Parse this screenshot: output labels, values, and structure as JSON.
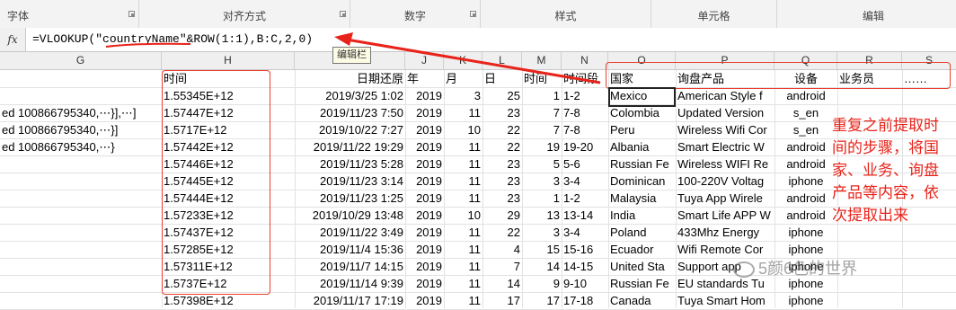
{
  "ribbon": {
    "groups": [
      {
        "label": "字体",
        "launcher": true
      },
      {
        "label": "对齐方式",
        "launcher": true
      },
      {
        "label": "数字",
        "launcher": true
      },
      {
        "label": "样式",
        "launcher": false
      },
      {
        "label": "单元格",
        "launcher": false
      },
      {
        "label": "编辑",
        "launcher": false
      }
    ]
  },
  "formula_bar": {
    "fx_label": "fx",
    "formula": "=VLOOKUP(\"countryName\"&ROW(1:1),B:C,2,0)",
    "tooltip": "编辑栏"
  },
  "columns": [
    "G",
    "H",
    "I",
    "J",
    "K",
    "L",
    "M",
    "N",
    "O",
    "P",
    "Q",
    "R",
    "S"
  ],
  "header_row": {
    "H": "时间",
    "I": "日期还原",
    "J": "年",
    "K": "月",
    "L": "日",
    "M": "时间",
    "N": "时间段",
    "O": "国家",
    "P": "询盘产品",
    "Q": "设备",
    "R": "业务员",
    "S": "……"
  },
  "rows": [
    {
      "F": "",
      "G": "",
      "H": "1.55345E+12",
      "I": "2019/3/25 1:02",
      "J": "2019",
      "K": "3",
      "L": "25",
      "M": "1",
      "N": "1-2",
      "O": "Mexico",
      "P": "American Style f",
      "Q": "android",
      "R": ""
    },
    {
      "F": "ed",
      "G": "100866795340,⋯}],⋯]",
      "H": "1.57447E+12",
      "I": "2019/11/23 7:50",
      "J": "2019",
      "K": "11",
      "L": "23",
      "M": "7",
      "N": "7-8",
      "O": "Colombia",
      "P": "Updated Version",
      "Q": "s_en",
      "R": ""
    },
    {
      "F": "ed",
      "G": "100866795340,⋯}]",
      "H": "1.5717E+12",
      "I": "2019/10/22 7:27",
      "J": "2019",
      "K": "10",
      "L": "22",
      "M": "7",
      "N": "7-8",
      "O": "Peru",
      "P": "Wireless Wifi Cor",
      "Q": "s_en",
      "R": ""
    },
    {
      "F": "ed",
      "G": "100866795340,⋯}",
      "H": "1.57442E+12",
      "I": "2019/11/22 19:29",
      "J": "2019",
      "K": "11",
      "L": "22",
      "M": "19",
      "N": "19-20",
      "O": "Albania",
      "P": "Smart Electric W",
      "Q": "android",
      "R": ""
    },
    {
      "F": "",
      "G": "",
      "H": "1.57446E+12",
      "I": "2019/11/23 5:28",
      "J": "2019",
      "K": "11",
      "L": "23",
      "M": "5",
      "N": "5-6",
      "O": "Russian Fe",
      "P": "Wireless WIFI Re",
      "Q": "android",
      "R": ""
    },
    {
      "F": "",
      "G": "",
      "H": "1.57445E+12",
      "I": "2019/11/23 3:14",
      "J": "2019",
      "K": "11",
      "L": "23",
      "M": "3",
      "N": "3-4",
      "O": "Dominican",
      "P": "100-220V Voltag",
      "Q": "iphone",
      "R": ""
    },
    {
      "F": "",
      "G": "",
      "H": "1.57444E+12",
      "I": "2019/11/23 1:25",
      "J": "2019",
      "K": "11",
      "L": "23",
      "M": "1",
      "N": "1-2",
      "O": "Malaysia",
      "P": "Tuya App Wirele",
      "Q": "android",
      "R": ""
    },
    {
      "F": "",
      "G": "",
      "H": "1.57233E+12",
      "I": "2019/10/29 13:48",
      "J": "2019",
      "K": "10",
      "L": "29",
      "M": "13",
      "N": "13-14",
      "O": "India",
      "P": "Smart Life APP W",
      "Q": "android",
      "R": ""
    },
    {
      "F": "",
      "G": "",
      "H": "1.57437E+12",
      "I": "2019/11/22 3:49",
      "J": "2019",
      "K": "11",
      "L": "22",
      "M": "3",
      "N": "3-4",
      "O": "Poland",
      "P": "433Mhz Energy",
      "Q": "iphone",
      "R": ""
    },
    {
      "F": "",
      "G": "",
      "H": "1.57285E+12",
      "I": "2019/11/4 15:36",
      "J": "2019",
      "K": "11",
      "L": "4",
      "M": "15",
      "N": "15-16",
      "O": "Ecuador",
      "P": "Wifi Remote Cor",
      "Q": "iphone",
      "R": ""
    },
    {
      "F": "",
      "G": "",
      "H": "1.57311E+12",
      "I": "2019/11/7 14:15",
      "J": "2019",
      "K": "11",
      "L": "7",
      "M": "14",
      "N": "14-15",
      "O": "United Sta",
      "P": "Support app",
      "Q": "iphone",
      "R": ""
    },
    {
      "F": "",
      "G": "",
      "H": "1.5737E+12",
      "I": "2019/11/14 9:39",
      "J": "2019",
      "K": "11",
      "L": "14",
      "M": "9",
      "N": "9-10",
      "O": "Russian Fe",
      "P": "EU standards Tu",
      "Q": "iphone",
      "R": ""
    },
    {
      "F": "",
      "G": "",
      "H": "1.57398E+12",
      "I": "2019/11/17 17:19",
      "J": "2019",
      "K": "11",
      "L": "17",
      "M": "17",
      "N": "17-18",
      "O": "Canada",
      "P": "Tuya Smart Hom",
      "Q": "iphone",
      "R": ""
    }
  ],
  "annotation": "重复之前提取时间的步骤，将国家、业务、询盘产品等内容，依次提取出来",
  "watermark": "5颜6色的世界",
  "colors": {
    "annotation_red": "#e8231a",
    "selection_border": "#222222"
  }
}
